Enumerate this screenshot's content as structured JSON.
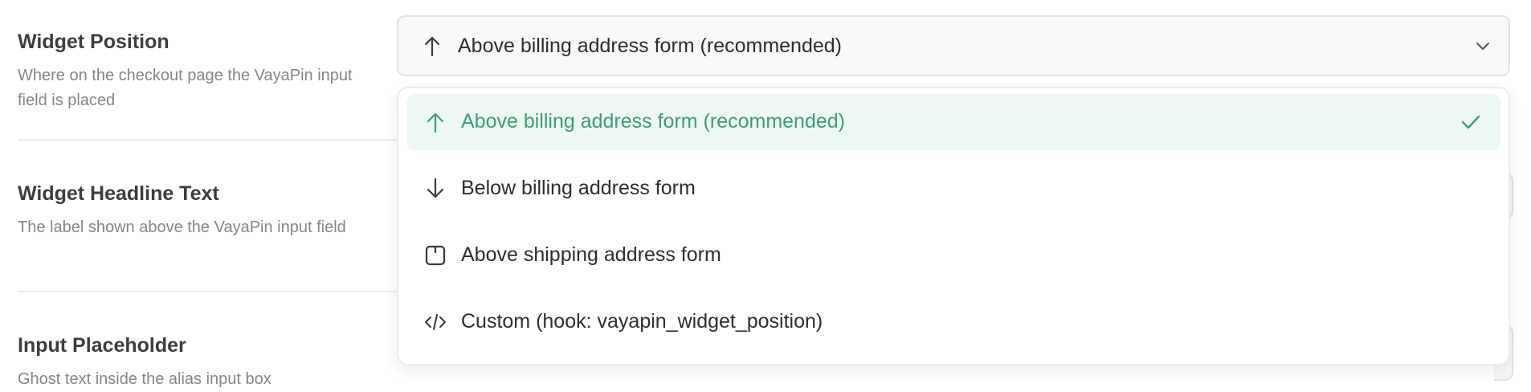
{
  "settings": [
    {
      "title": "Widget Position",
      "desc": "Where on the checkout page the VayaPin input field is placed"
    },
    {
      "title": "Widget Headline Text",
      "desc": "The label shown above the VayaPin input field"
    },
    {
      "title": "Input Placeholder",
      "desc": "Ghost text inside the alias input box"
    }
  ],
  "position_select": {
    "value": "Above billing address form (recommended)",
    "icon": "arrow-up-icon",
    "options": [
      {
        "label": "Above billing address form (recommended)",
        "icon": "arrow-up-icon",
        "selected": true
      },
      {
        "label": "Below billing address form",
        "icon": "arrow-down-icon",
        "selected": false
      },
      {
        "label": "Above shipping address form",
        "icon": "panel-top-icon",
        "selected": false
      },
      {
        "label": "Custom (hook: vayapin_widget_position)",
        "icon": "code-icon",
        "selected": false
      }
    ]
  },
  "colors": {
    "accent": "#3e9c79",
    "selected_bg": "#eef8f2",
    "border": "#e3e3e3",
    "muted_text": "#868686"
  }
}
